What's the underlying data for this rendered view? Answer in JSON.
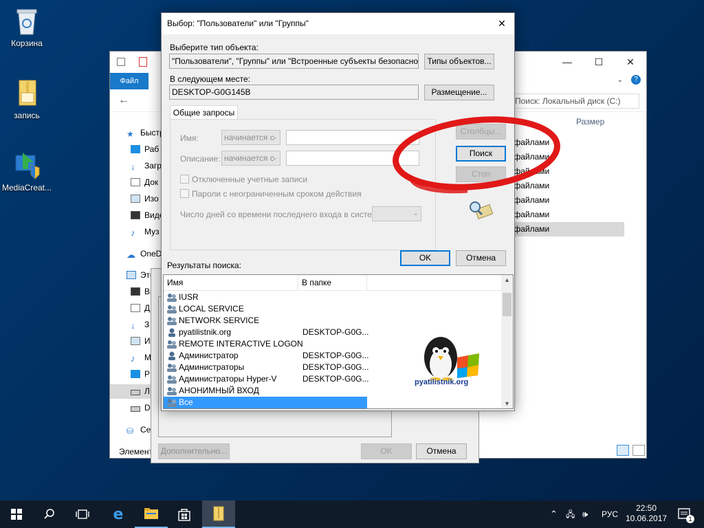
{
  "desktop": {
    "icons": [
      {
        "label": "Корзина"
      },
      {
        "label": "запись"
      },
      {
        "label": "MediaCreat..."
      }
    ]
  },
  "explorer": {
    "file_tab": "Файл",
    "search_placeholder": "Поиск: Локальный диск (C:)",
    "column_size": "Размер",
    "nav": [
      {
        "label": "Быстр"
      },
      {
        "label": "Раб"
      },
      {
        "label": "Загр"
      },
      {
        "label": "Док"
      },
      {
        "label": "Изо"
      },
      {
        "label": "Виде"
      },
      {
        "label": "Муз"
      },
      {
        "label": "OneD"
      },
      {
        "label": "Этот к"
      },
      {
        "label": "Ви"
      },
      {
        "label": "Д"
      },
      {
        "label": "З"
      },
      {
        "label": "И"
      },
      {
        "label": "М"
      },
      {
        "label": "Р"
      },
      {
        "label": "Л"
      },
      {
        "label": "D"
      },
      {
        "label": "Се"
      }
    ],
    "file_rows": [
      "с файлами",
      "с файлами",
      "с файлами",
      "с файлами",
      "с файлами",
      "с файлами",
      "с файлами"
    ],
    "status_left": "Элемент"
  },
  "bg_dialog": {
    "advanced_label": "Дополнительно...",
    "ok_label": "OK",
    "cancel_label": "Отмена"
  },
  "dialog": {
    "title": "Выбор: \"Пользователи\" или \"Группы\"",
    "object_type_label": "Выберите тип объекта:",
    "object_type_value": "\"Пользователи\", \"Группы\" или \"Встроенные субъекты безопасности\"",
    "object_types_button": "Типы объектов...",
    "location_label": "В следующем месте:",
    "location_value": "DESKTOP-G0G145B",
    "locations_button": "Размещение...",
    "tab_label": "Общие запросы",
    "name_label": "Имя:",
    "name_op": "начинается с",
    "description_label": "Описание:",
    "description_op": "начинается с",
    "disabled_accounts": "Отключенные учетные записи",
    "non_expiring": "Пароли с неограниченным сроком действия",
    "days_since_logon": "Число дней со времени последнего входа в систему:",
    "columns_button": "Столбцы...",
    "search_button": "Поиск",
    "stop_button": "Стоп",
    "ok_button": "OK",
    "cancel_button": "Отмена",
    "results_label": "Результаты поиска:",
    "results_columns": {
      "name": "Имя",
      "folder": "В папке"
    },
    "results": [
      {
        "name": "IUSR",
        "folder": ""
      },
      {
        "name": "LOCAL SERVICE",
        "folder": ""
      },
      {
        "name": "NETWORK SERVICE",
        "folder": ""
      },
      {
        "name": "pyatilistnik.org",
        "folder": "DESKTOP-G0G..."
      },
      {
        "name": "REMOTE INTERACTIVE LOGON",
        "folder": ""
      },
      {
        "name": "Администратор",
        "folder": "DESKTOP-G0G..."
      },
      {
        "name": "Администраторы",
        "folder": "DESKTOP-G0G..."
      },
      {
        "name": "Администраторы Hyper-V",
        "folder": "DESKTOP-G0G..."
      },
      {
        "name": "АНОНИМНЫЙ ВХОД",
        "folder": ""
      },
      {
        "name": "Все",
        "folder": ""
      }
    ],
    "watermark": "pyatilistnik.org"
  },
  "taskbar": {
    "lang": "РУС",
    "time": "22:50",
    "date": "10.06.2017",
    "notification_count": "1"
  },
  "colors": {
    "accent": "#0078d7",
    "selection": "#3399ff",
    "annotation": "#e11818"
  }
}
